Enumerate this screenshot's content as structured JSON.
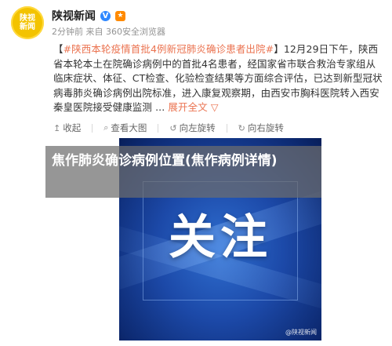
{
  "post": {
    "avatar_line1": "陕视",
    "avatar_line2": "新闻",
    "author": "陕视新闻",
    "verified_mark": "V",
    "meta": "2分钟前 来自 360安全浏览器",
    "content": {
      "bracket_open": "【",
      "topic": "#陕西本轮疫情首批4例新冠肺炎确诊患者出院#",
      "bracket_close": "】",
      "body": "12月29日下午，陕西省本轮本土在院确诊病例中的首批4名患者，经国家省市联合救治专家组从临床症状、体征、CT检查、化验检查结果等方面综合评估，已达到新型冠状病毒肺炎确诊病例出院标准，进入康复观察期，由西安市胸科医院转入西安秦皇医院接受健康监测",
      "ellipsis": " ...",
      "expand_label": "展开全文 ▽"
    },
    "actions": [
      {
        "icon": "star-icon",
        "label": "收起"
      },
      {
        "icon": "search-icon",
        "label": "查看大图"
      },
      {
        "icon": "rotate-left-icon",
        "label": "向左旋转"
      },
      {
        "icon": "rotate-right-icon",
        "label": "向右旋转"
      }
    ],
    "image": {
      "text": "关注",
      "watermark": "@陕视新闻"
    }
  },
  "overlay": {
    "title": "焦作肺炎确诊病例位置(焦作病例详情)"
  },
  "colors": {
    "link": "#eb7350",
    "avatar": "#f3c300",
    "overlay": "rgba(110,110,110,0.72)",
    "image_blue": "#1c49a8"
  }
}
